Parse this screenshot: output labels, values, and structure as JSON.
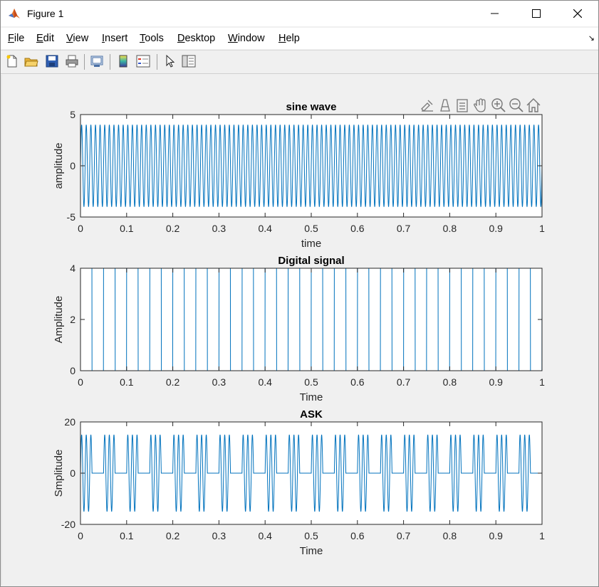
{
  "window": {
    "title": "Figure 1",
    "controls": [
      "minimize",
      "maximize",
      "close"
    ]
  },
  "menubar": {
    "items": [
      {
        "label": "File",
        "mnemonic": "F"
      },
      {
        "label": "Edit",
        "mnemonic": "E"
      },
      {
        "label": "View",
        "mnemonic": "V"
      },
      {
        "label": "Insert",
        "mnemonic": "I"
      },
      {
        "label": "Tools",
        "mnemonic": "T"
      },
      {
        "label": "Desktop",
        "mnemonic": "D"
      },
      {
        "label": "Window",
        "mnemonic": "W"
      },
      {
        "label": "Help",
        "mnemonic": "H"
      }
    ]
  },
  "toolbar": {
    "icons": [
      "new-figure-icon",
      "open-file-icon",
      "save-icon",
      "print-icon",
      "link-plot-icon",
      "insert-colorbar-icon",
      "insert-legend-icon",
      "edit-plot-icon",
      "property-inspector-icon"
    ]
  },
  "axes_toolbar": {
    "icons": [
      "brush-icon",
      "data-tips-icon",
      "export-icon",
      "pan-icon",
      "zoom-in-icon",
      "zoom-out-icon",
      "home-icon"
    ]
  },
  "colors": {
    "line": "#0072BD",
    "axes_background": "#ffffff",
    "figure_background": "#f0f0f0"
  },
  "chart_data": [
    {
      "type": "line",
      "title": "sine wave",
      "xlabel": "time",
      "ylabel": "amplitude",
      "xlim": [
        0,
        1
      ],
      "ylim": [
        -5,
        5
      ],
      "xticks": [
        "0",
        "0.1",
        "0.2",
        "0.3",
        "0.4",
        "0.5",
        "0.6",
        "0.7",
        "0.8",
        "0.9",
        "1"
      ],
      "yticks": [
        "5",
        "0",
        "-5"
      ],
      "series": [
        {
          "function": "4*sin(2*pi*100*t)",
          "amplitude": 4,
          "frequency_hz": 100
        }
      ]
    },
    {
      "type": "line",
      "title": "Digital signal",
      "xlabel": "Time",
      "ylabel": "Amplitude",
      "xlim": [
        0,
        1
      ],
      "ylim": [
        0,
        4
      ],
      "xticks": [
        "0",
        "0.1",
        "0.2",
        "0.3",
        "0.4",
        "0.5",
        "0.6",
        "0.7",
        "0.8",
        "0.9",
        "1"
      ],
      "yticks": [
        "4",
        "2",
        "0"
      ],
      "series": [
        {
          "function": "square wave",
          "high": 4,
          "low": 0,
          "period": 0.05,
          "duty": 0.5
        }
      ]
    },
    {
      "type": "line",
      "title": "ASK",
      "xlabel": "Time",
      "ylabel": "Smplitude",
      "xlim": [
        0,
        1
      ],
      "ylim": [
        -20,
        20
      ],
      "xticks": [
        "0",
        "0.1",
        "0.2",
        "0.3",
        "0.4",
        "0.5",
        "0.6",
        "0.7",
        "0.8",
        "0.9",
        "1"
      ],
      "yticks": [
        "20",
        "0",
        "-20"
      ],
      "series": [
        {
          "function": "carrier x digital signal",
          "peak": 15,
          "bit_period": 0.05
        }
      ]
    }
  ]
}
